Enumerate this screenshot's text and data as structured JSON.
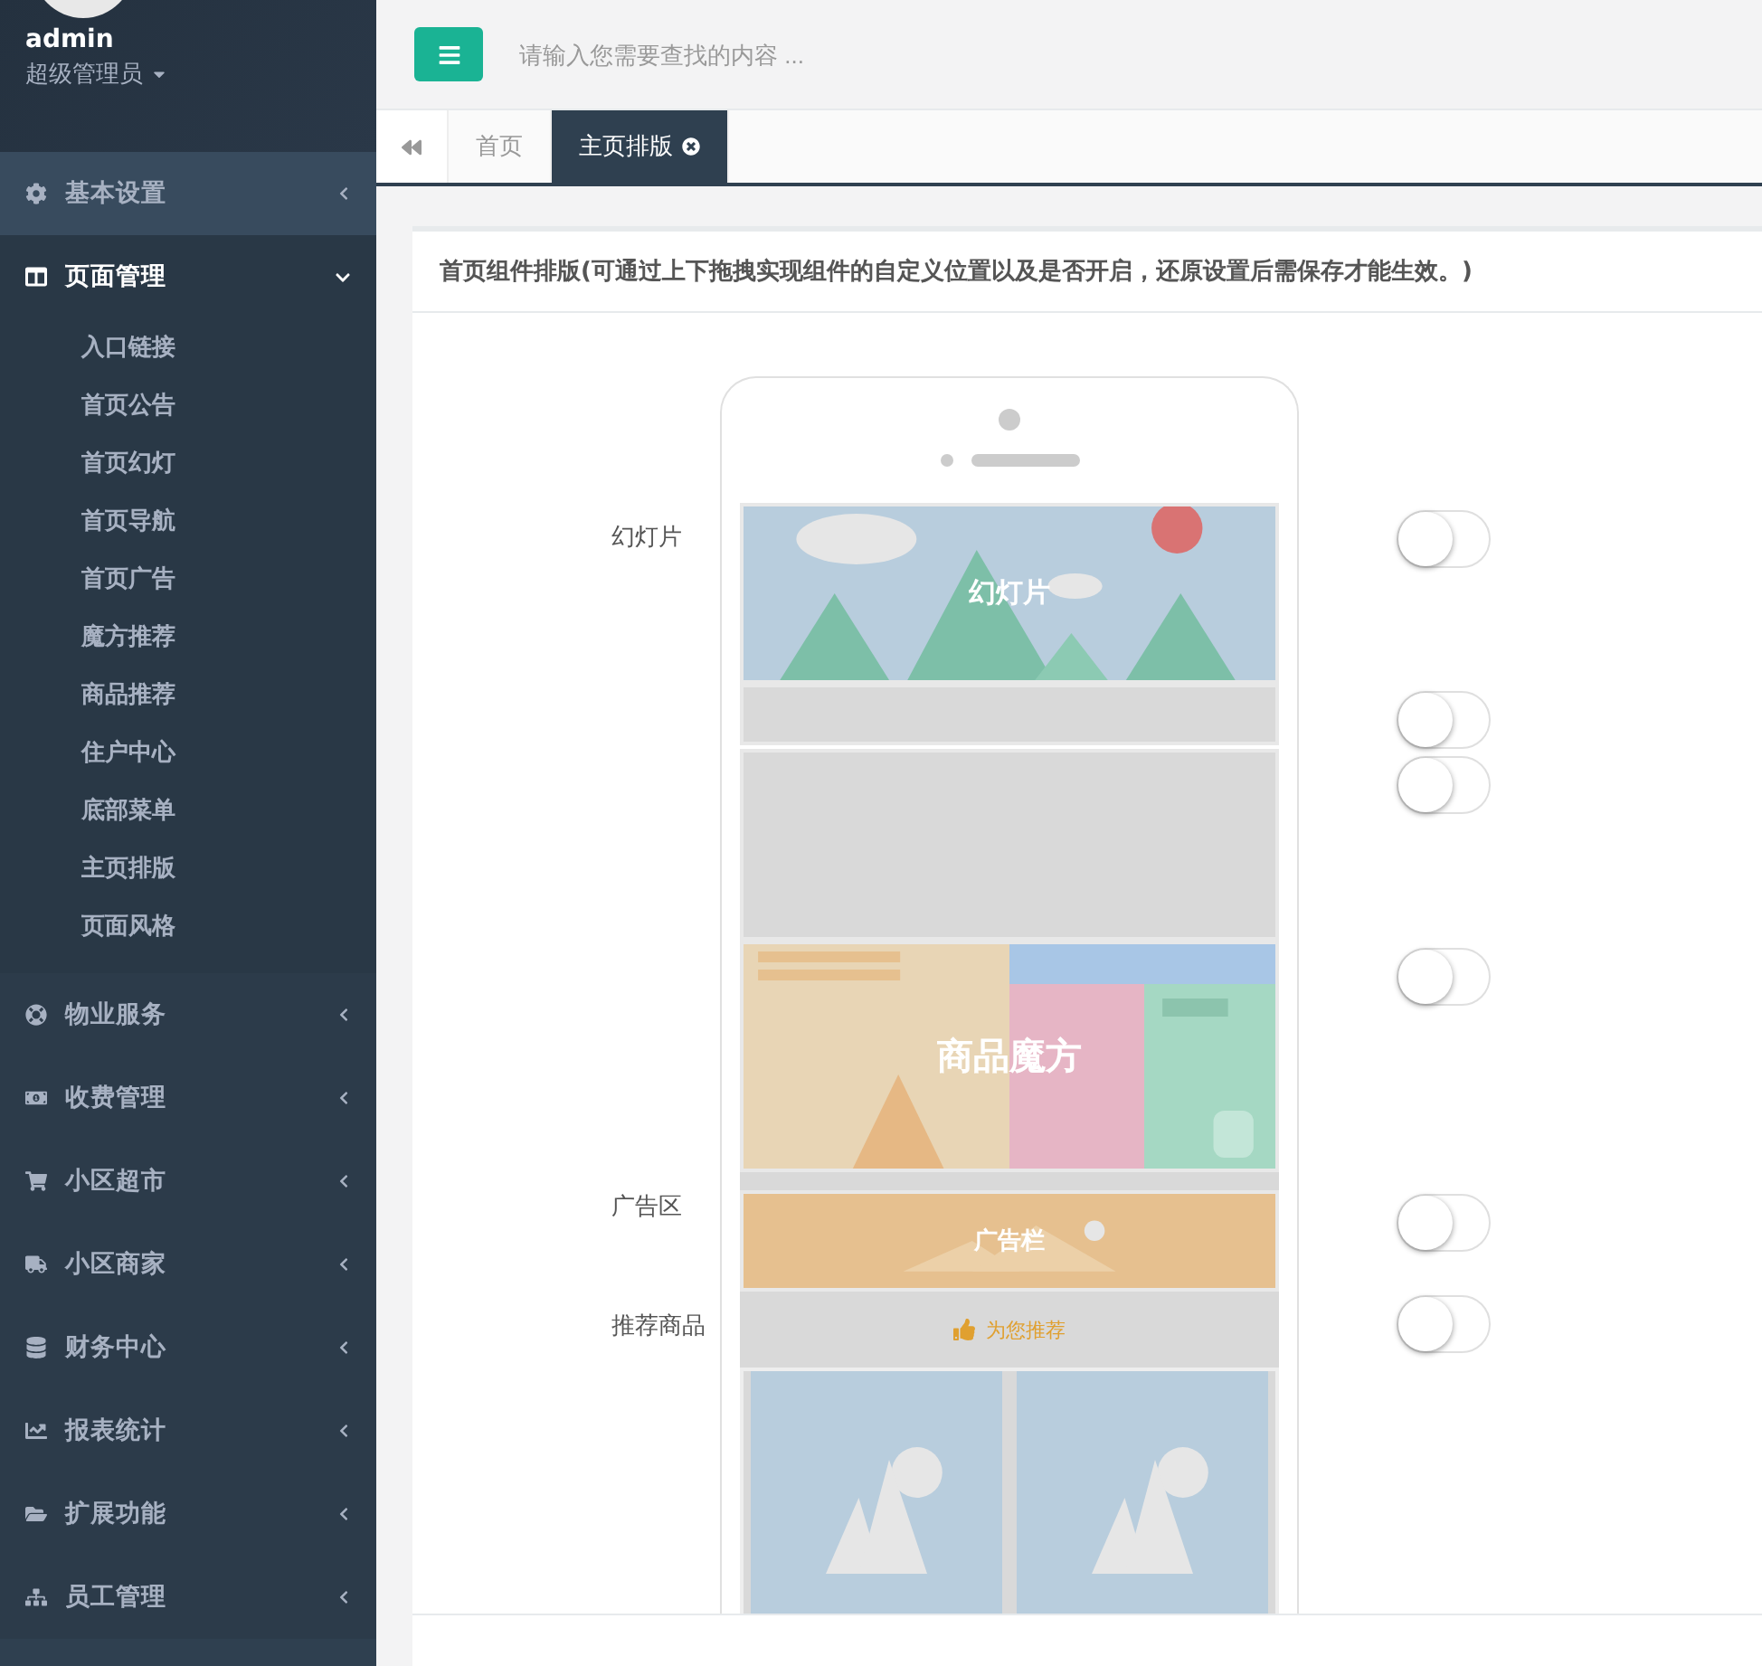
{
  "user": {
    "name": "admin",
    "role": "超级管理员"
  },
  "menu": [
    {
      "label": "基本设置",
      "expanded": false,
      "selected": true
    },
    {
      "label": "页面管理",
      "expanded": true,
      "selected": false,
      "children": [
        {
          "label": "入口链接"
        },
        {
          "label": "首页公告"
        },
        {
          "label": "首页幻灯"
        },
        {
          "label": "首页导航"
        },
        {
          "label": "首页广告"
        },
        {
          "label": "魔方推荐"
        },
        {
          "label": "商品推荐"
        },
        {
          "label": "住户中心"
        },
        {
          "label": "底部菜单"
        },
        {
          "label": "主页排版"
        },
        {
          "label": "页面风格"
        }
      ]
    },
    {
      "label": "物业服务",
      "expanded": false,
      "selected": false
    },
    {
      "label": "收费管理",
      "expanded": false,
      "selected": false
    },
    {
      "label": "小区超市",
      "expanded": false,
      "selected": false
    },
    {
      "label": "小区商家",
      "expanded": false,
      "selected": false
    },
    {
      "label": "财务中心",
      "expanded": false,
      "selected": false
    },
    {
      "label": "报表统计",
      "expanded": false,
      "selected": false
    },
    {
      "label": "扩展功能",
      "expanded": false,
      "selected": false
    },
    {
      "label": "员工管理",
      "expanded": false,
      "selected": false
    }
  ],
  "search": {
    "placeholder": "请输入您需要查找的内容 ..."
  },
  "tabs": [
    {
      "label": "首页",
      "selected": false,
      "closable": false
    },
    {
      "label": "主页排版",
      "selected": true,
      "closable": true
    }
  ],
  "card": {
    "title": "首页组件排版(可通过上下拖拽实现组件的自定义位置以及是否开启，还原设置后需保存才能生效。)"
  },
  "sections": [
    {
      "kind": "slide",
      "label": "幻灯片",
      "caption": "幻灯片",
      "on": false
    },
    {
      "kind": "block",
      "on": false
    },
    {
      "kind": "block",
      "on": false
    },
    {
      "kind": "cube",
      "caption": "商品魔方",
      "on": false
    },
    {
      "kind": "ad",
      "label": "广告区",
      "caption": "广告栏",
      "on": false
    },
    {
      "kind": "recommend",
      "label": "推荐商品",
      "caption": "为您推荐",
      "on": false
    }
  ]
}
